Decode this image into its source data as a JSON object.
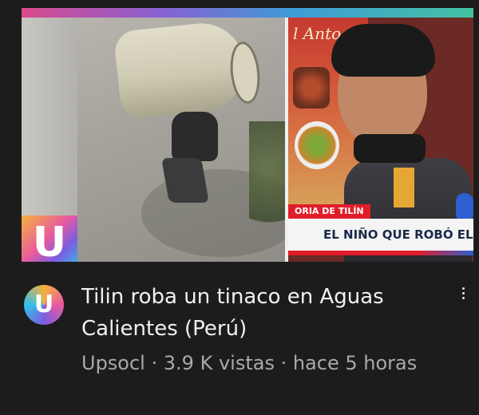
{
  "thumbnail": {
    "menu_board_text": "l Anto",
    "logo_letter": "U",
    "lower_third_tag": "ORIA DE TILÍN",
    "lower_third_headline": "EL NIÑO QUE ROBÓ EL"
  },
  "video": {
    "title": "Tilin roba un tinaco en Aguas Calientes (Perú)",
    "channel": "Upsocl",
    "separator": "·",
    "views": "3.9 K vistas",
    "age": "hace 5 horas"
  },
  "channel_avatar": {
    "letter": "U"
  },
  "menu_icon": "more-vertical-icon",
  "colors": {
    "background": "#1c1c1c",
    "title_text": "#f1f1f1",
    "meta_text": "#a9a9a9",
    "accent_red": "#e21d2a"
  }
}
